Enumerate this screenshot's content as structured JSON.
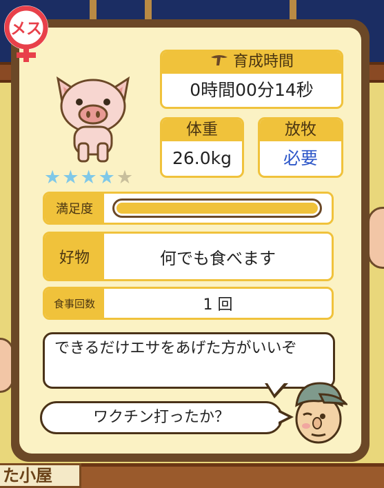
{
  "badge": {
    "label": "メス",
    "color": "#e8404a"
  },
  "pig": {
    "rating": 4,
    "max_rating": 5,
    "star_color": "#7fc8e8",
    "empty_star_color": "#c8bf9c"
  },
  "growth_time": {
    "label": "育成時間",
    "value": "0時間00分14秒",
    "icon": "whistle-icon"
  },
  "weight": {
    "label": "体重",
    "value": "26.0kg"
  },
  "grazing": {
    "label": "放牧",
    "value": "必要",
    "value_color": "#2c56c8"
  },
  "satisfaction": {
    "label": "満足度",
    "level": 1.0
  },
  "favorite": {
    "label": "好物",
    "value": "何でも食べます"
  },
  "meals": {
    "label": "食事回数",
    "value": "1 回"
  },
  "speech": {
    "line1": "できるだけエサをあげた方がいいぞ",
    "line2": "ワクチン打ったか？"
  },
  "background": {
    "sign_text": "た小屋"
  },
  "colors": {
    "panel_border": "#6b4827",
    "panel_bg": "#fbf2c4",
    "accent": "#f0c23b"
  }
}
